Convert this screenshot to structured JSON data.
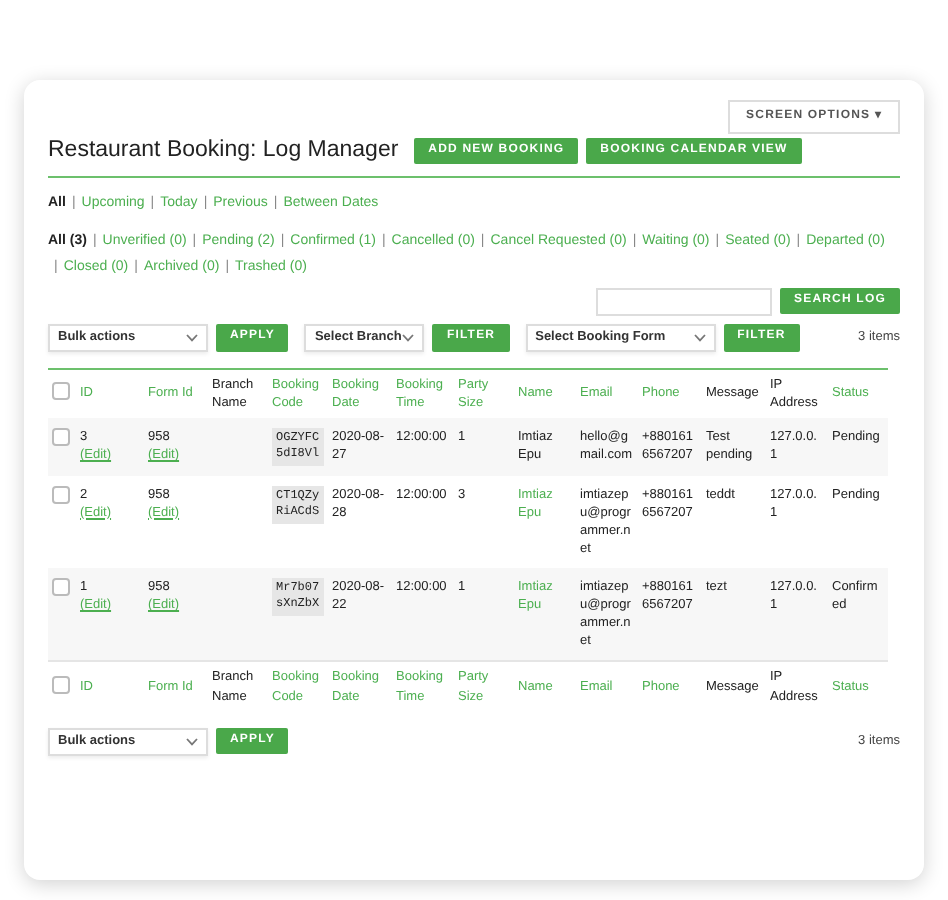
{
  "screen_options": {
    "label": "SCREEN OPTIONS",
    "caret": "▾"
  },
  "title": "Restaurant Booking: Log Manager",
  "header_buttons": [
    "ADD NEW BOOKING",
    "BOOKING CALENDAR VIEW"
  ],
  "separator": "|",
  "date_views": [
    {
      "label": "All",
      "selected": true
    },
    {
      "label": "Upcoming",
      "selected": false
    },
    {
      "label": "Today",
      "selected": false
    },
    {
      "label": "Previous",
      "selected": false
    },
    {
      "label": "Between Dates",
      "selected": false
    }
  ],
  "status_views": [
    {
      "label": "All (3)",
      "selected": true
    },
    {
      "label": "Unverified (0)",
      "selected": false
    },
    {
      "label": "Pending (2)",
      "selected": false
    },
    {
      "label": "Confirmed (1)",
      "selected": false
    },
    {
      "label": "Cancelled (0)",
      "selected": false
    },
    {
      "label": "Cancel Requested (0)",
      "selected": false
    },
    {
      "label": "Waiting (0)",
      "selected": false
    },
    {
      "label": "Seated (0)",
      "selected": false
    },
    {
      "label": "Departed (0)",
      "selected": false
    },
    {
      "label": "Closed (0)",
      "selected": false
    },
    {
      "label": "Archived (0)",
      "selected": false
    },
    {
      "label": "Trashed (0)",
      "selected": false
    }
  ],
  "search": {
    "button": "SEARCH LOG"
  },
  "top_toolbar": {
    "bulk_actions": "Bulk actions",
    "apply": "APPLY",
    "branch": "Select Branch",
    "branch_filter": "FILTER",
    "form": "Select Booking Form",
    "form_filter": "FILTER",
    "count": "3 items"
  },
  "table": {
    "select_all_checked": false,
    "columns": [
      {
        "label": "ID",
        "sortable": true
      },
      {
        "label": "Form Id",
        "sortable": true
      },
      {
        "label": "Branch Name",
        "sortable": false
      },
      {
        "label": "Booking Code",
        "sortable": true
      },
      {
        "label": "Booking Date",
        "sortable": true
      },
      {
        "label": "Booking Time",
        "sortable": true
      },
      {
        "label": "Party Size",
        "sortable": true
      },
      {
        "label": "Name",
        "sortable": true
      },
      {
        "label": "Email",
        "sortable": true
      },
      {
        "label": "Phone",
        "sortable": true
      },
      {
        "label": "Message",
        "sortable": false
      },
      {
        "label": "IP Address",
        "sortable": false
      },
      {
        "label": "Status",
        "sortable": true
      }
    ],
    "rows": [
      {
        "checked": false,
        "id": "3",
        "id_edit": "(Edit)",
        "form_id": "958",
        "form_edit": "(Edit)",
        "booking_code": "OGZYFC5dI8Vl",
        "booking_date": "2020-08-27",
        "booking_time": "12:00:00",
        "party_size": "1",
        "name": "Imtiaz Epu",
        "name_linked": false,
        "email": "hello@gmail.com",
        "phone": "+8801616567207",
        "message": "Test pending",
        "ip": "127.0.0.1",
        "status": "Pending"
      },
      {
        "checked": false,
        "id": "2",
        "id_edit": "(Edit)",
        "form_id": "958",
        "form_edit": "(Edit)",
        "booking_code": "CT1QZyRiACdS",
        "booking_date": "2020-08-28",
        "booking_time": "12:00:00",
        "party_size": "3",
        "name": "Imtiaz Epu",
        "name_linked": true,
        "email": "imtiazepu@programmer.net",
        "phone": "+8801616567207",
        "message": "teddt",
        "ip": "127.0.0.1",
        "status": "Pending"
      },
      {
        "checked": false,
        "id": "1",
        "id_edit": "(Edit)",
        "form_id": "958",
        "form_edit": "(Edit)",
        "booking_code": "Mr7b07sXnZbX",
        "booking_date": "2020-08-22",
        "booking_time": "12:00:00",
        "party_size": "1",
        "name": "Imtiaz Epu",
        "name_linked": true,
        "email": "imtiazepu@programmer.net",
        "phone": "+8801616567207",
        "message": "tezt",
        "ip": "127.0.0.1",
        "status": "Confirmed"
      }
    ],
    "footer_select_all_checked": false,
    "footer_columns": [
      {
        "label": "ID",
        "sortable": true
      },
      {
        "label": "Form Id",
        "sortable": true
      },
      {
        "label": "Branch Name",
        "sortable": false
      },
      {
        "label": "Booking Code",
        "sortable": true
      },
      {
        "label": "Booking Date",
        "sortable": true
      },
      {
        "label": "Booking Time",
        "sortable": true
      },
      {
        "label": "Party Size",
        "sortable": true
      },
      {
        "label": "Name",
        "sortable": true
      },
      {
        "label": "Email",
        "sortable": true
      },
      {
        "label": "Phone",
        "sortable": true
      },
      {
        "label": "Message",
        "sortable": false
      },
      {
        "label": "IP Address",
        "sortable": false
      },
      {
        "label": "Status",
        "sortable": true
      }
    ]
  },
  "bottom_toolbar": {
    "bulk_actions": "Bulk actions",
    "apply": "APPLY",
    "count": "3 items"
  }
}
